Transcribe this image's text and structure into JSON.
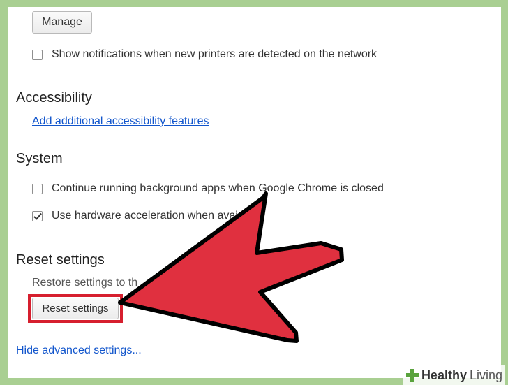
{
  "printers": {
    "manage_label": "Manage",
    "notify_label": "Show notifications when new printers are detected on the network",
    "notify_checked": false
  },
  "accessibility": {
    "title": "Accessibility",
    "link_label": "Add additional accessibility features"
  },
  "system": {
    "title": "System",
    "background_apps_label": "Continue running background apps when Google Chrome is closed",
    "background_apps_checked": false,
    "hw_accel_label": "Use hardware acceleration when avai",
    "hw_accel_checked": true
  },
  "reset": {
    "title": "Reset settings",
    "description": "Restore settings to th",
    "button_label": "Reset settings"
  },
  "footer": {
    "hide_advanced_label": "Hide advanced settings..."
  },
  "annotation": {
    "arrow_color": "#e0303f",
    "highlight_color": "#d61f2e",
    "arrow_icon": "arrow-pointer-icon"
  },
  "watermark": {
    "brand_bold": "Healthy",
    "brand_regular": "Living",
    "accent_color": "#5aa33d"
  }
}
